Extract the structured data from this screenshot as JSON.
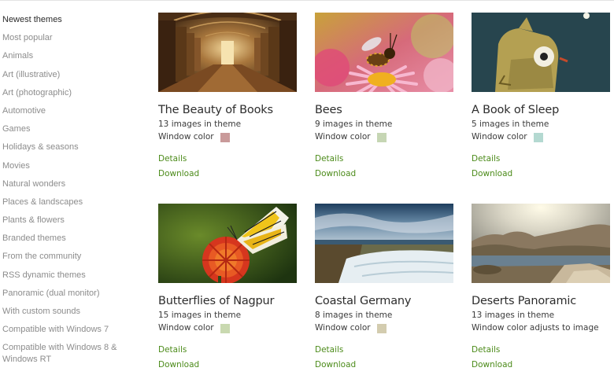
{
  "sidebar": {
    "items": [
      {
        "label": "Newest themes"
      },
      {
        "label": "Most popular"
      },
      {
        "label": "Animals"
      },
      {
        "label": "Art (illustrative)"
      },
      {
        "label": "Art (photographic)"
      },
      {
        "label": "Automotive"
      },
      {
        "label": "Games"
      },
      {
        "label": "Holidays & seasons"
      },
      {
        "label": "Movies"
      },
      {
        "label": "Natural wonders"
      },
      {
        "label": "Places & landscapes"
      },
      {
        "label": "Plants & flowers"
      },
      {
        "label": "Branded themes"
      },
      {
        "label": "From the community"
      },
      {
        "label": "RSS dynamic themes"
      },
      {
        "label": "Panoramic (dual monitor)"
      },
      {
        "label": "With custom sounds"
      },
      {
        "label": "Compatible with Windows 7"
      },
      {
        "label": "Compatible with Windows 8 & Windows RT"
      }
    ]
  },
  "themes": [
    {
      "title": "The Beauty of Books",
      "count": "13 images in theme",
      "window_color_label": "Window color",
      "swatch": "#c99a9a",
      "details": "Details",
      "download": "Download"
    },
    {
      "title": "Bees",
      "count": "9 images in theme",
      "window_color_label": "Window color",
      "swatch": "#c6d6b4",
      "details": "Details",
      "download": "Download"
    },
    {
      "title": "A Book of Sleep",
      "count": "5 images in theme",
      "window_color_label": "Window color",
      "swatch": "#b4d9d1",
      "details": "Details",
      "download": "Download"
    },
    {
      "title": "Butterflies of Nagpur",
      "count": "15 images in theme",
      "window_color_label": "Window color",
      "swatch": "#c9d9b0",
      "details": "Details",
      "download": "Download"
    },
    {
      "title": "Coastal Germany",
      "count": "8 images in theme",
      "window_color_label": "Window color",
      "swatch": "#d3ccaf",
      "details": "Details",
      "download": "Download"
    },
    {
      "title": "Deserts Panoramic",
      "count": "13 images in theme",
      "window_color_label": "Window color adjusts to image",
      "swatch": null,
      "details": "Details",
      "download": "Download"
    }
  ]
}
